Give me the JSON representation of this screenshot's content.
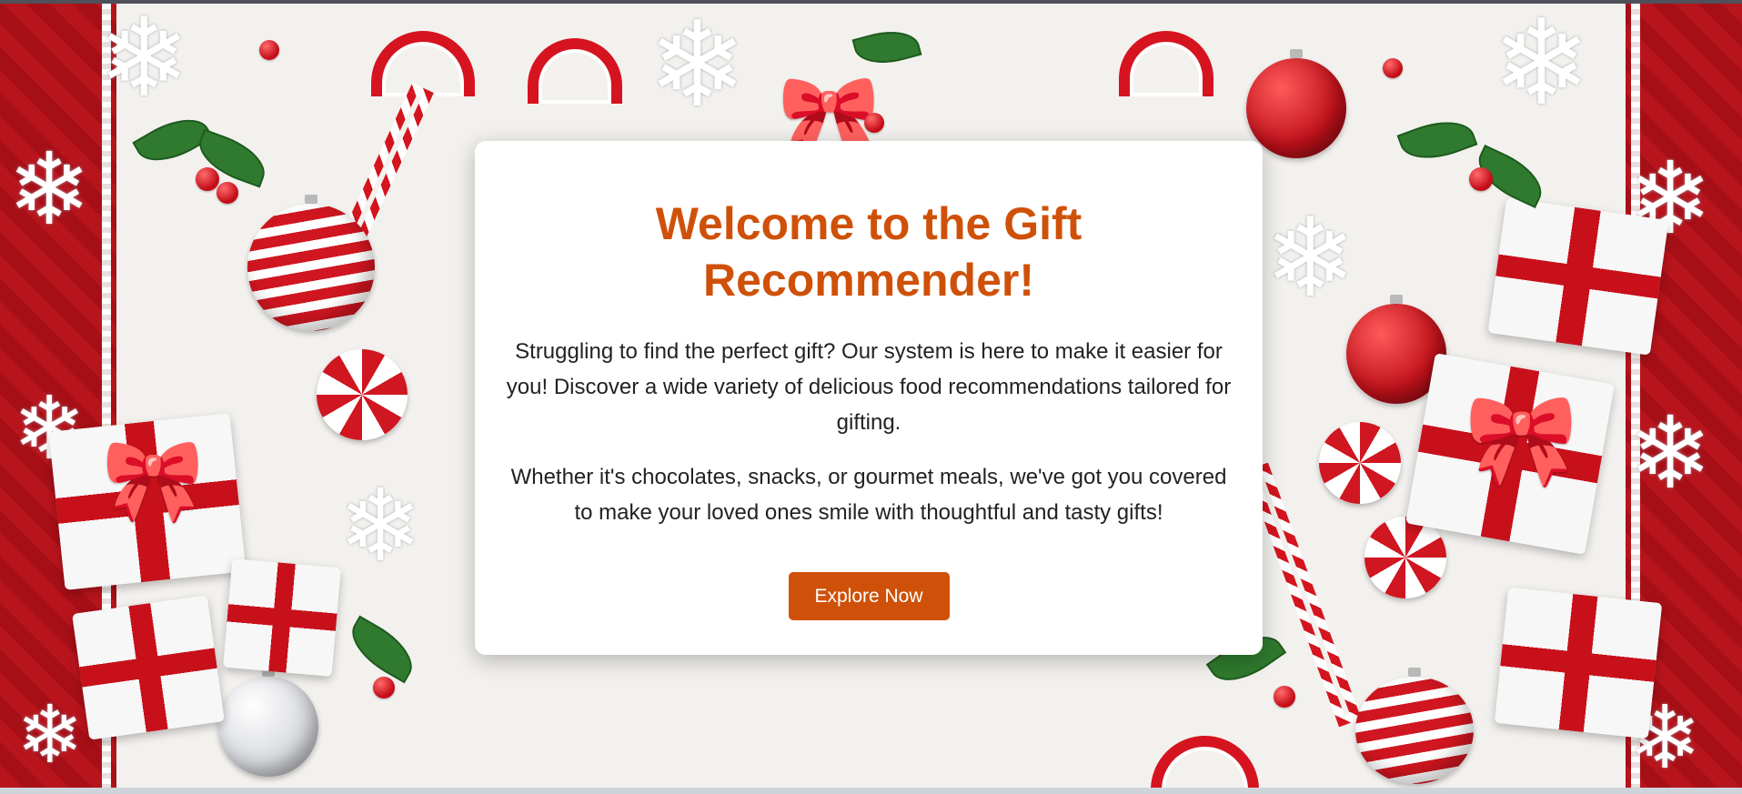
{
  "hero": {
    "title": "Welcome to the Gift Recommender!",
    "intro": "Struggling to find the perfect gift? Our system is here to make it easier for you! Discover a wide variety of delicious food recommendations tailored for gifting.",
    "details": "Whether it's chocolates, snacks, or gourmet meals, we've got you covered to make your loved ones smile with thoughtful and tasty gifts!",
    "cta_label": "Explore Now"
  },
  "background": {
    "theme": "christmas-decorations",
    "icons": [
      "snowflake-icon",
      "ornament-icon",
      "candy-cane-icon",
      "gift-box-icon",
      "holly-icon",
      "peppermint-icon"
    ]
  },
  "colors": {
    "accent": "#cf5109",
    "button_text": "#ffffff",
    "body_text": "#222222",
    "card_background": "#ffffff",
    "festive_red": "#c8101b"
  }
}
